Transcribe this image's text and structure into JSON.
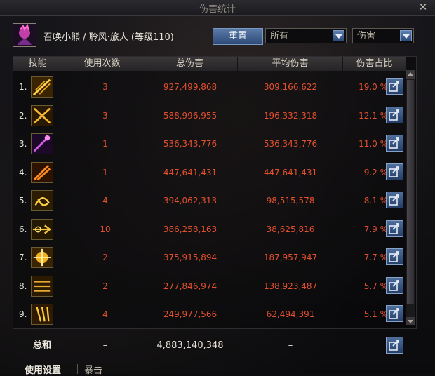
{
  "window": {
    "title": "伤害统计"
  },
  "character": {
    "name": "召唤小熊 / 聆风·旅人 (等级110)"
  },
  "toolbar": {
    "reset_label": "重置",
    "filter_scope": "所有",
    "filter_metric": "伤害"
  },
  "table": {
    "headers": [
      "技能",
      "使用次数",
      "总伤害",
      "平均伤害",
      "伤害占比"
    ],
    "rows": [
      {
        "index": "1.",
        "uses": "3",
        "total": "927,499,868",
        "avg": "309,166,622",
        "share": "19.0 %",
        "icon": "sword-slash-icon"
      },
      {
        "index": "2.",
        "uses": "3",
        "total": "588,996,955",
        "avg": "196,332,318",
        "share": "12.1 %",
        "icon": "cross-slash-icon"
      },
      {
        "index": "3.",
        "uses": "1",
        "total": "536,343,776",
        "avg": "536,343,776",
        "share": "11.0 %",
        "icon": "purple-blade-icon"
      },
      {
        "index": "4.",
        "uses": "1",
        "total": "447,641,431",
        "avg": "447,641,431",
        "share": "9.2 %",
        "icon": "fire-blade-icon"
      },
      {
        "index": "5.",
        "uses": "4",
        "total": "394,062,313",
        "avg": "98,515,578",
        "share": "8.1 %",
        "icon": "swirl-strike-icon"
      },
      {
        "index": "6.",
        "uses": "10",
        "total": "386,258,163",
        "avg": "38,625,816",
        "share": "7.9 %",
        "icon": "arrow-thrust-icon"
      },
      {
        "index": "7.",
        "uses": "2",
        "total": "375,915,894",
        "avg": "187,957,947",
        "share": "7.7 %",
        "icon": "golden-burst-icon"
      },
      {
        "index": "8.",
        "uses": "2",
        "total": "277,846,974",
        "avg": "138,923,487",
        "share": "5.7 %",
        "icon": "triple-slash-icon"
      },
      {
        "index": "9.",
        "uses": "4",
        "total": "249,977,566",
        "avg": "62,494,391",
        "share": "5.1 %",
        "icon": "claw-strike-icon"
      }
    ]
  },
  "totals": {
    "label": "总和",
    "uses": "–",
    "total": "4,883,140,348",
    "avg": "–"
  },
  "tabs": {
    "settings": "使用设置",
    "crit": "暴击"
  },
  "colors": {
    "accent_red": "#e2502e",
    "button_blue": "#2e4a78"
  }
}
